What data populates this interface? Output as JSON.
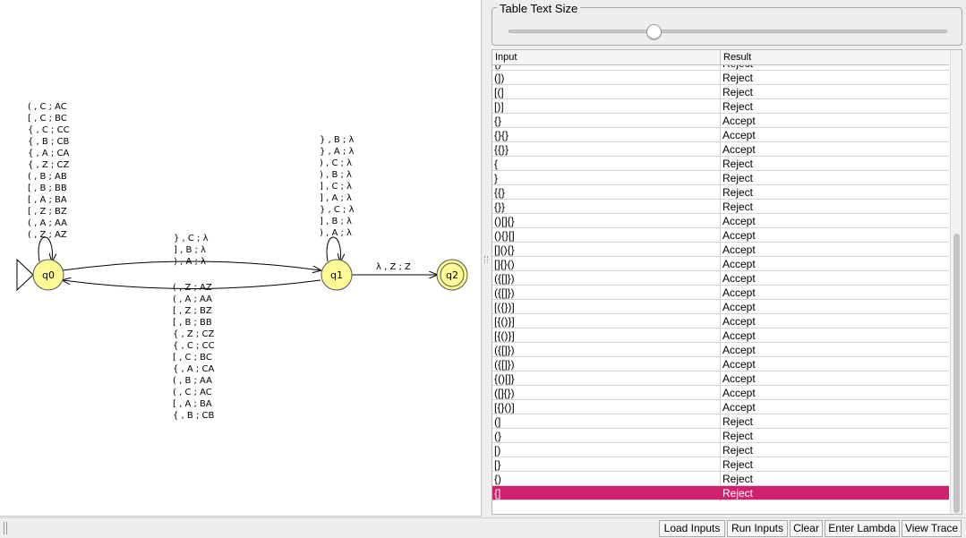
{
  "automaton": {
    "states": [
      {
        "id": "q0",
        "label": "q0",
        "initial": true,
        "final": false
      },
      {
        "id": "q1",
        "label": "q1",
        "initial": false,
        "final": false
      },
      {
        "id": "q2",
        "label": "q2",
        "initial": false,
        "final": true
      }
    ],
    "q0_loop_labels": [
      "( , C ; AC",
      "[ , C ; BC",
      "{ , C ; CC",
      "{ , B ; CB",
      "{ , A ; CA",
      "{ , Z ; CZ",
      "( , B ; AB",
      "[ , B ; BB",
      "[ , A ; BA",
      "[ , Z ; BZ",
      "( , A ; AA",
      "( , Z ; AZ"
    ],
    "q1_to_q0_labels": [
      "} , C ; λ",
      "] , B ; λ",
      ") , A ; λ"
    ],
    "q0_to_q1_labels": [
      "( , Z ; AZ",
      "( , A ; AA",
      "[ , Z ; BZ",
      "[ , B ; BB",
      "{ , Z ; CZ",
      "{ , C ; CC",
      "[ , C ; BC",
      "{ , A ; CA",
      "( , B ; AA",
      "( , C ; AC",
      "[ , A ; BA",
      "{ , B ; CB"
    ],
    "q1_loop_labels": [
      "} , B ; λ",
      "} , A ; λ",
      ") , C ; λ",
      ") , B ; λ",
      "] , C ; λ",
      "] , A ; λ",
      "} , C ; λ",
      "] , B ; λ",
      ") , A ; λ"
    ],
    "q1_to_q2_label": "λ , Z ; Z",
    "state_fill": "#fdfa96"
  },
  "size_panel": {
    "title": "Table Text Size",
    "slider_value": 0.33
  },
  "table": {
    "headers": {
      "input": "Input",
      "result": "Result"
    },
    "partial_top_row": {
      "input": "{)",
      "result": "Reject"
    },
    "rows": [
      {
        "input": "(])",
        "result": "Reject"
      },
      {
        "input": "[(]",
        "result": "Reject"
      },
      {
        "input": "[)]",
        "result": "Reject"
      },
      {
        "input": "{}",
        "result": "Accept"
      },
      {
        "input": "{}{}",
        "result": "Accept"
      },
      {
        "input": "{{}}",
        "result": "Accept"
      },
      {
        "input": "{",
        "result": "Reject"
      },
      {
        "input": "}",
        "result": "Reject"
      },
      {
        "input": "{{}",
        "result": "Reject"
      },
      {
        "input": "{}}",
        "result": "Reject"
      },
      {
        "input": "()[]{}",
        "result": "Accept"
      },
      {
        "input": "(){}[]",
        "result": "Accept"
      },
      {
        "input": "[](){}",
        "result": "Accept"
      },
      {
        "input": "[]{}()",
        "result": "Accept"
      },
      {
        "input": "({[]})",
        "result": "Accept"
      },
      {
        "input": "({[]})",
        "result": "Accept"
      },
      {
        "input": "[({})]",
        "result": "Accept"
      },
      {
        "input": "[{()}]",
        "result": "Accept"
      },
      {
        "input": "[{()}]",
        "result": "Accept"
      },
      {
        "input": "({[]})",
        "result": "Accept"
      },
      {
        "input": "({[]})",
        "result": "Accept"
      },
      {
        "input": "{()[]}",
        "result": "Accept"
      },
      {
        "input": "([]{})",
        "result": "Accept"
      },
      {
        "input": "[{}()]",
        "result": "Accept"
      },
      {
        "input": "(]",
        "result": "Reject"
      },
      {
        "input": "(}",
        "result": "Reject"
      },
      {
        "input": "[)",
        "result": "Reject"
      },
      {
        "input": "[}",
        "result": "Reject"
      },
      {
        "input": "{)",
        "result": "Reject"
      },
      {
        "input": "{]",
        "result": "Reject",
        "selected": true
      }
    ],
    "selected_color": "#d0216f"
  },
  "buttons": {
    "load_inputs": "Load Inputs",
    "run_inputs": "Run Inputs",
    "clear": "Clear",
    "enter_lambda": "Enter Lambda",
    "view_trace": "View Trace"
  }
}
